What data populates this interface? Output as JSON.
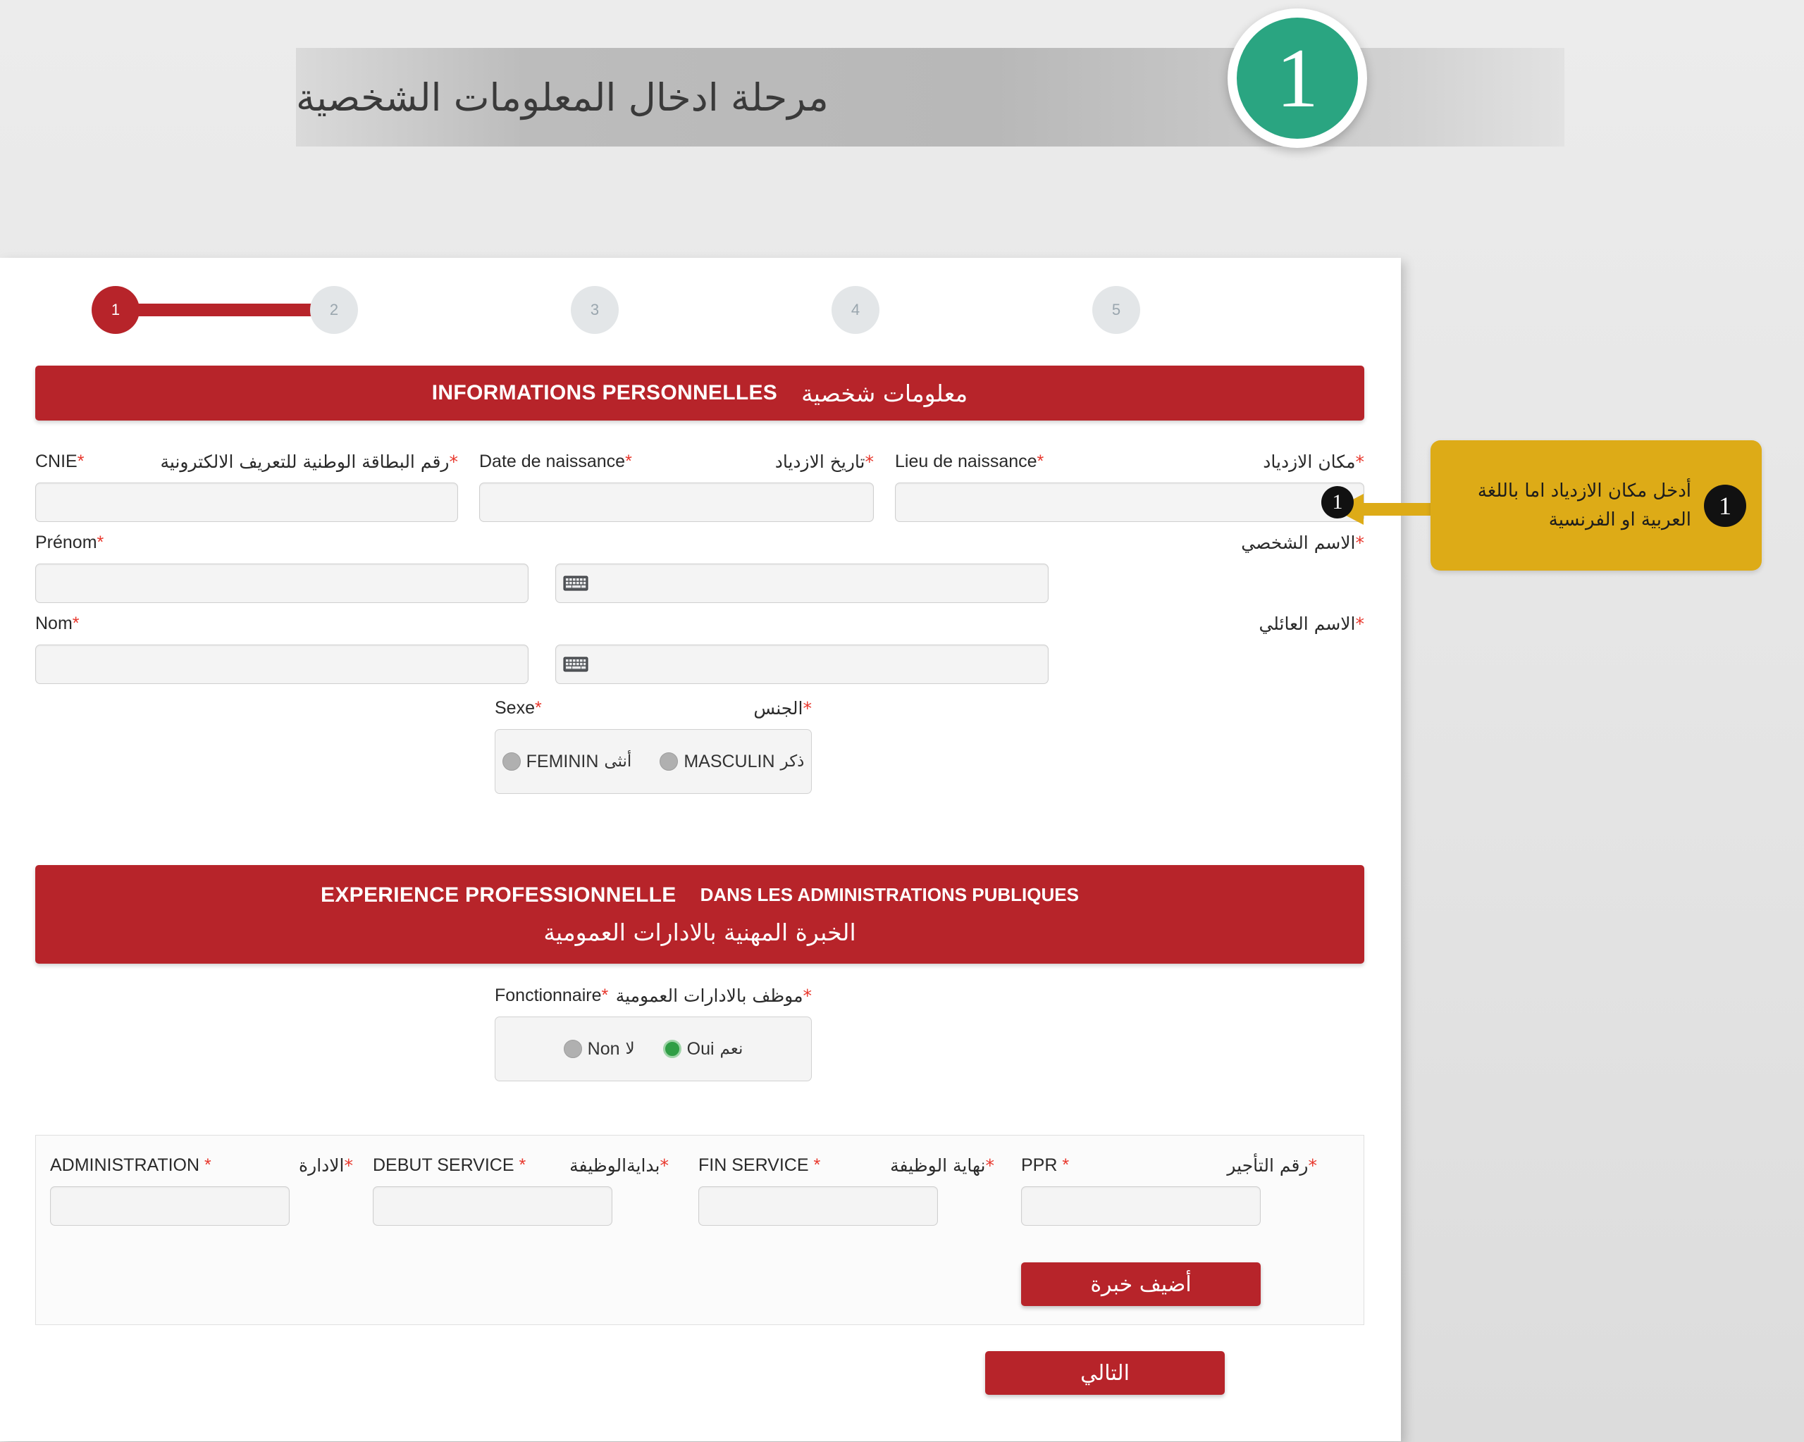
{
  "header": {
    "title_ar": "مرحلة ادخال المعلومات الشخصية",
    "step_number": "1",
    "circle_color": "#2aa581"
  },
  "stepper": {
    "steps": [
      {
        "number": "1",
        "active": true
      },
      {
        "number": "2",
        "active": false
      },
      {
        "number": "3",
        "active": false
      },
      {
        "number": "4",
        "active": false
      },
      {
        "number": "5",
        "active": false
      }
    ],
    "active_color": "#b7242a",
    "inactive_color": "#e3e6e8"
  },
  "sections": {
    "personal": {
      "title_fr": "INFORMATIONS PERSONNELLES",
      "title_ar": "معلومات شخصية",
      "bar_color": "#b7242a"
    },
    "experience": {
      "title_fr_1": "EXPERIENCE PROFESSIONNELLE",
      "title_fr_2": "DANS LES ADMINISTRATIONS PUBLIQUES",
      "title_ar": "الخبرة المهنية بالادارات العمومية",
      "bar_color": "#b7242a"
    }
  },
  "personal_fields": {
    "cnie": {
      "label_fr": "CNIE",
      "label_ar": "رقم البطاقة الوطنية للتعريف الالكترونية",
      "required": "*",
      "value": ""
    },
    "date_naissance": {
      "label_fr": "Date de naissance",
      "label_ar": "تاريخ الازدياد",
      "required": "*",
      "value": ""
    },
    "lieu_naissance": {
      "label_fr": "Lieu de naissance",
      "label_ar": "مكان الازدياد",
      "required": "*",
      "value": "",
      "marker": "1"
    },
    "prenom": {
      "label_fr": "Prénom",
      "label_ar": "الاسم الشخصي",
      "required": "*",
      "value": "",
      "value_ar": ""
    },
    "nom": {
      "label_fr": "Nom",
      "label_ar": "الاسم العائلي",
      "required": "*",
      "value": "",
      "value_ar": ""
    },
    "sexe": {
      "label_fr": "Sexe",
      "label_ar": "الجنس",
      "required": "*",
      "options": [
        {
          "fr": "MASCULIN",
          "ar": "ذكر",
          "selected": false
        },
        {
          "fr": "FEMININ",
          "ar": "أنثى",
          "selected": false
        }
      ]
    }
  },
  "experience_fields": {
    "fonctionnaire": {
      "label_fr": "Fonctionnaire",
      "label_ar": "موظف بالادارات العمومية",
      "required": "*",
      "options": [
        {
          "fr": "Oui",
          "ar": "نعم",
          "selected": true
        },
        {
          "fr": "Non",
          "ar": "لا",
          "selected": false
        }
      ]
    },
    "columns": [
      {
        "label_fr": "ADMINISTRATION",
        "label_ar": "الادارة",
        "required": "*",
        "value": ""
      },
      {
        "label_fr": "DEBUT SERVICE",
        "label_ar": "بدايةالوظيفة",
        "required": "*",
        "value": ""
      },
      {
        "label_fr": "FIN SERVICE",
        "label_ar": "نهاية الوظيفة",
        "required": "*",
        "value": ""
      },
      {
        "label_fr": "PPR",
        "label_ar": "رقم التأجير",
        "required": "*",
        "value": ""
      }
    ],
    "add_button": "أضيف خبرة"
  },
  "footer": {
    "next_button": "التالي"
  },
  "annotation": {
    "number": "1",
    "text": "أدخل مكان الازدياد اما باللغة العربية او الفرنسية",
    "background": "#ddab17"
  }
}
